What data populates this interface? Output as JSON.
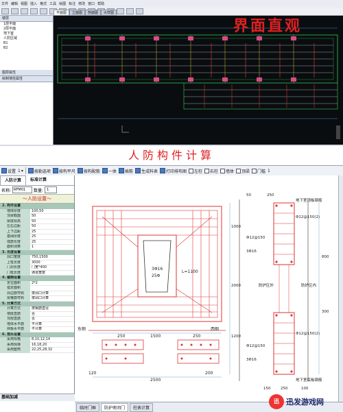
{
  "top_window": {
    "menu": [
      "文件",
      "编辑",
      "视图",
      "插入",
      "格式",
      "工具",
      "绘图",
      "标注",
      "修改",
      "窗口",
      "帮助"
    ],
    "left_panel": {
      "header": "楼层",
      "items": [
        "1层平面",
        "2层平面",
        "地下室",
        "人防区域",
        "B1",
        "B2"
      ],
      "header2": "图层属性",
      "header3": "绘制墙柱属性"
    },
    "tabs": [
      "平面图",
      "立面图",
      "剖面图",
      "大样图"
    ],
    "headline": "界面直观"
  },
  "section_title": "人防构件计算",
  "toolbar": {
    "items": [
      "设置",
      "1",
      "按勒选项",
      "按构平尺",
      "按构配筋",
      "一体",
      "插筋",
      "生成料表",
      "打印排布图",
      "左柱",
      "右柱",
      "墙体",
      "顶梁",
      "门槛",
      "1"
    ]
  },
  "left_panel2": {
    "tabs": [
      "人防计算",
      "标准计算"
    ],
    "name_label": "名称:",
    "name_value": "RFM01",
    "qty_label": "数量:",
    "qty_value": "1",
    "group_title": "～人防设置～",
    "props": [
      {
        "sec": true,
        "k": "2. 构件设置"
      },
      {
        "k": "墙体厚度",
        "v": "100,50"
      },
      {
        "k": "顶梁截面",
        "v": "50"
      },
      {
        "k": "梁底标高",
        "v": "50"
      },
      {
        "k": "左右边距",
        "v": "50"
      },
      {
        "k": "上下边距",
        "v": "25"
      },
      {
        "k": "基础厚度",
        "v": "25"
      },
      {
        "k": "插筋长度",
        "v": "25"
      },
      {
        "k": "面积测算",
        "v": "1"
      },
      {
        "sec": true,
        "k": "3. 长度设置"
      },
      {
        "k": "洞口宽度",
        "v": "750,1500"
      },
      {
        "k": "上框长度",
        "v": "3000"
      },
      {
        "k": "门洞长度",
        "v": "门宽*400"
      },
      {
        "k": "门框长度",
        "v": "通道宽度"
      },
      {
        "sec": true,
        "k": "4. 编辑设置"
      },
      {
        "k": "定位面积",
        "v": "2*2"
      },
      {
        "k": "指定面积",
        "v": ""
      },
      {
        "k": "洞边筋弯钩",
        "v": "按洞口计算"
      },
      {
        "k": "梁箍筋弯钩",
        "v": "按洞口计算"
      },
      {
        "sec": true,
        "k": "5. 计算方式"
      },
      {
        "k": "计算方式",
        "v": "按钢筋直径"
      },
      {
        "k": "墙底直筋",
        "v": "否"
      },
      {
        "k": "顶部直筋",
        "v": "否"
      },
      {
        "k": "墙体水平筋",
        "v": "不计算"
      },
      {
        "k": "挡板水平筋",
        "v": "不计算"
      },
      {
        "sec": true,
        "k": "6. 搭头设置"
      },
      {
        "k": "采用规格",
        "v": "8,10,12,14"
      },
      {
        "k": "采用焊接",
        "v": "16,18,20"
      },
      {
        "k": "采用套筒",
        "v": "22,25,28,32"
      }
    ],
    "bottom_label": "基础加减"
  },
  "drawing": {
    "labels": {
      "east": "东侧",
      "west": "西侧",
      "center_upper": "3Φ16",
      "center_lower": "25Φ",
      "door_dim": "L=1100",
      "protect_out": "防护区外",
      "protect_in": "防护区内",
      "top_note": "地下室顶板钢筋",
      "bot_note": "地下室底板钢筋",
      "bar_a": "Φ12@150(2)",
      "bar_b": "Φ12@150",
      "bar_c": "3Φ16",
      "bar_d": "Φ12@150(2)",
      "bar_e": "Φ12@150",
      "bar_f": "3Φ16",
      "dim_2000": "2000",
      "dim_1000": "1000",
      "dim_250a": "250",
      "dim_250b": "250",
      "dim_250c": "250",
      "dim_1500": "1500",
      "dim_300": "300",
      "dim_250d": "250",
      "dim_1200": "1200",
      "dim_800": "800",
      "dim_120": "120",
      "dim_200": "200",
      "dim_2500": "2500",
      "dim_100": "100",
      "dim_150": "150",
      "dim_50": "50"
    },
    "bottom_tabs": [
      "临时门框",
      "防护密闭门",
      "柱表计算"
    ]
  },
  "watermark": {
    "logo_char": "迅",
    "text": "迅发游戏网"
  }
}
